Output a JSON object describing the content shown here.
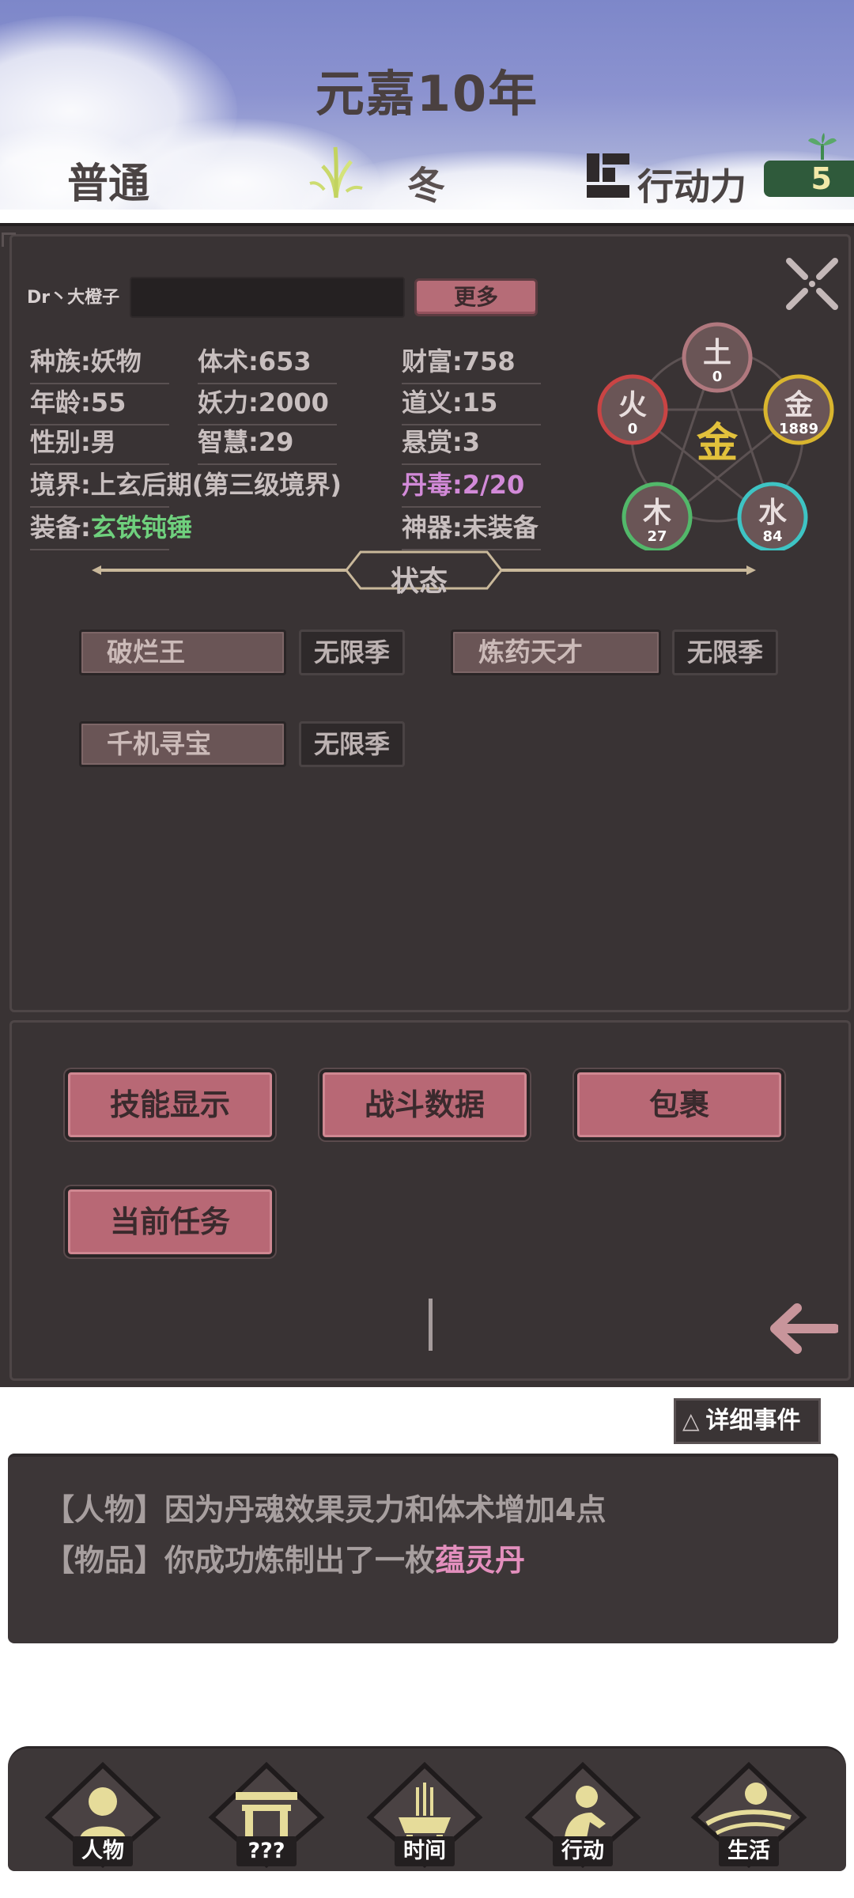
{
  "header": {
    "year": "元嘉10年",
    "difficulty": "普通",
    "season": "冬",
    "action_label": "行动力",
    "action_points": "5"
  },
  "character": {
    "name": "Dr丶大橙子",
    "more_button": "更多",
    "stats": {
      "race": "种族:妖物",
      "age": "年龄:55",
      "gender": "性别:男",
      "realm": "境界:上玄后期(第三级境界)",
      "equip_prefix": "装备:",
      "equip_value": "玄铁钝锤",
      "body": "体术:653",
      "demon_power": "妖力:2000",
      "wisdom": "智慧:29",
      "wealth": "财富:758",
      "justice": "道义:15",
      "bounty": "悬赏:3",
      "pill_poison": "丹毒:2/20",
      "artifact": "神器:未装备"
    },
    "elements": {
      "center": "金",
      "earth": {
        "name": "土",
        "value": "0"
      },
      "fire": {
        "name": "火",
        "value": "0"
      },
      "metal": {
        "name": "金",
        "value": "1889"
      },
      "wood": {
        "name": "木",
        "value": "27"
      },
      "water": {
        "name": "水",
        "value": "84"
      }
    },
    "status_title": "状态",
    "statuses": [
      {
        "name": "破烂王",
        "duration": "无限季"
      },
      {
        "name": "炼药天才",
        "duration": "无限季"
      },
      {
        "name": "千机寻宝",
        "duration": "无限季"
      }
    ]
  },
  "actions": {
    "skills": "技能显示",
    "battle_data": "战斗数据",
    "bag": "包裹",
    "current_task": "当前任务"
  },
  "events": {
    "detail_button": "详细事件",
    "log": [
      {
        "tag": "【人物】",
        "text": "因为丹魂效果灵力和体术增加4点",
        "highlight": ""
      },
      {
        "tag": "【物品】",
        "text": "你成功炼制出了一枚",
        "highlight": "蕴灵丹"
      }
    ]
  },
  "nav": {
    "items": [
      "人物",
      "???",
      "时间",
      "行动",
      "生活"
    ]
  },
  "colors": {
    "panel": "#393334",
    "button": "#b86875",
    "equip_green": "#6fd07d",
    "poison_purple": "#d28ad8",
    "highlight_pink": "#e38fbd",
    "action_box": "#2f5a3b"
  }
}
